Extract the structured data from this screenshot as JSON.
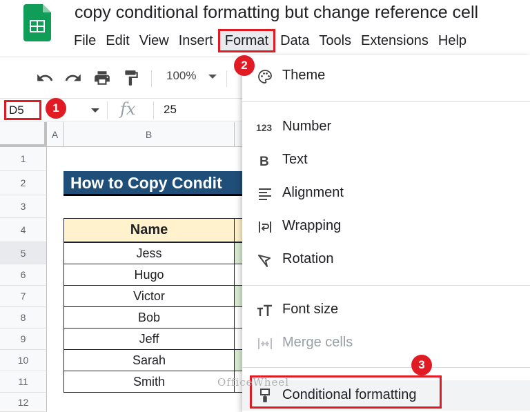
{
  "app": {
    "doc_title": "copy conditional formatting but change reference cell",
    "logo_icon": "google-sheets-icon",
    "logo_color": "#0f9d58"
  },
  "menubar": {
    "items": [
      "File",
      "Edit",
      "View",
      "Insert",
      "Format",
      "Data",
      "Tools",
      "Extensions",
      "Help"
    ],
    "active": "Format"
  },
  "toolbar": {
    "icons": [
      "undo-icon",
      "redo-icon",
      "print-icon",
      "paint-format-icon"
    ],
    "zoom": "100%"
  },
  "formula_bar": {
    "name_box": "D5",
    "fx": "fx",
    "value": "25"
  },
  "grid": {
    "columns": [
      "A",
      "B"
    ],
    "rows": [
      "1",
      "2",
      "3",
      "4",
      "5",
      "6",
      "7",
      "8",
      "9",
      "10",
      "11",
      "12"
    ],
    "banner": "How to Copy Condit",
    "table_header": "Name",
    "names": [
      "Jess",
      "Hugo",
      "Victor",
      "Bob",
      "Jeff",
      "Sarah",
      "Smith"
    ]
  },
  "format_menu": {
    "items": [
      {
        "label": "Theme",
        "icon": "palette-icon"
      },
      {
        "label": "Number",
        "icon": "number-123-icon"
      },
      {
        "label": "Text",
        "icon": "bold-b-icon"
      },
      {
        "label": "Alignment",
        "icon": "align-left-icon"
      },
      {
        "label": "Wrapping",
        "icon": "wrap-text-icon"
      },
      {
        "label": "Rotation",
        "icon": "text-rotation-icon"
      },
      {
        "label": "Font size",
        "icon": "font-size-icon"
      },
      {
        "label": "Merge cells",
        "icon": "merge-cells-icon"
      },
      {
        "label": "Conditional formatting",
        "icon": "paint-roller-icon"
      }
    ]
  },
  "steps": [
    "1",
    "2",
    "3"
  ],
  "watermark": "OfficeWheel",
  "colors": {
    "highlight_red": "#e01b24",
    "banner_blue": "#1f4e79",
    "header_fill": "#fff2cc"
  }
}
